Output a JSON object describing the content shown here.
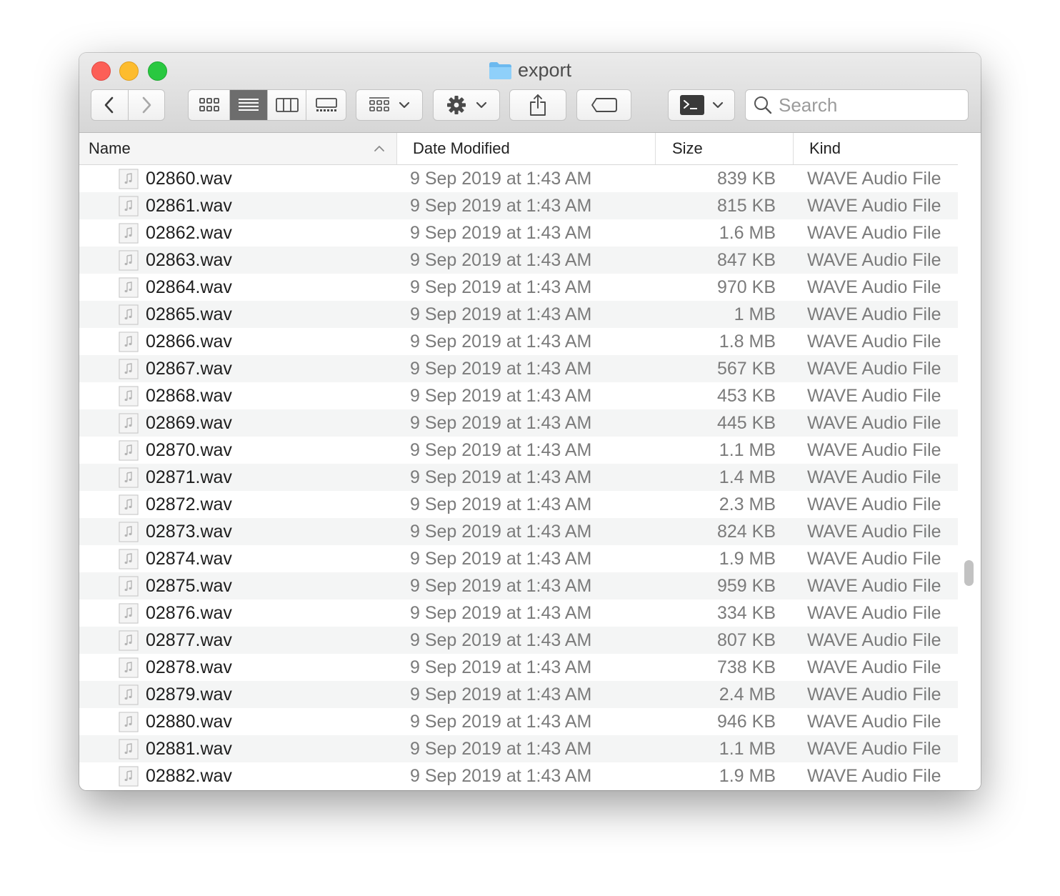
{
  "window": {
    "title": "export"
  },
  "toolbar": {
    "view_modes": [
      "icon-view",
      "list-view",
      "column-view",
      "gallery-view"
    ],
    "active_view": "list-view"
  },
  "search": {
    "placeholder": "Search"
  },
  "columns": {
    "name": "Name",
    "date": "Date Modified",
    "size": "Size",
    "kind": "Kind"
  },
  "files": [
    {
      "name": "02860.wav",
      "date": "9 Sep 2019 at 1:43 AM",
      "size": "839 KB",
      "kind": "WAVE Audio File"
    },
    {
      "name": "02861.wav",
      "date": "9 Sep 2019 at 1:43 AM",
      "size": "815 KB",
      "kind": "WAVE Audio File"
    },
    {
      "name": "02862.wav",
      "date": "9 Sep 2019 at 1:43 AM",
      "size": "1.6 MB",
      "kind": "WAVE Audio File"
    },
    {
      "name": "02863.wav",
      "date": "9 Sep 2019 at 1:43 AM",
      "size": "847 KB",
      "kind": "WAVE Audio File"
    },
    {
      "name": "02864.wav",
      "date": "9 Sep 2019 at 1:43 AM",
      "size": "970 KB",
      "kind": "WAVE Audio File"
    },
    {
      "name": "02865.wav",
      "date": "9 Sep 2019 at 1:43 AM",
      "size": "1 MB",
      "kind": "WAVE Audio File"
    },
    {
      "name": "02866.wav",
      "date": "9 Sep 2019 at 1:43 AM",
      "size": "1.8 MB",
      "kind": "WAVE Audio File"
    },
    {
      "name": "02867.wav",
      "date": "9 Sep 2019 at 1:43 AM",
      "size": "567 KB",
      "kind": "WAVE Audio File"
    },
    {
      "name": "02868.wav",
      "date": "9 Sep 2019 at 1:43 AM",
      "size": "453 KB",
      "kind": "WAVE Audio File"
    },
    {
      "name": "02869.wav",
      "date": "9 Sep 2019 at 1:43 AM",
      "size": "445 KB",
      "kind": "WAVE Audio File"
    },
    {
      "name": "02870.wav",
      "date": "9 Sep 2019 at 1:43 AM",
      "size": "1.1 MB",
      "kind": "WAVE Audio File"
    },
    {
      "name": "02871.wav",
      "date": "9 Sep 2019 at 1:43 AM",
      "size": "1.4 MB",
      "kind": "WAVE Audio File"
    },
    {
      "name": "02872.wav",
      "date": "9 Sep 2019 at 1:43 AM",
      "size": "2.3 MB",
      "kind": "WAVE Audio File"
    },
    {
      "name": "02873.wav",
      "date": "9 Sep 2019 at 1:43 AM",
      "size": "824 KB",
      "kind": "WAVE Audio File"
    },
    {
      "name": "02874.wav",
      "date": "9 Sep 2019 at 1:43 AM",
      "size": "1.9 MB",
      "kind": "WAVE Audio File"
    },
    {
      "name": "02875.wav",
      "date": "9 Sep 2019 at 1:43 AM",
      "size": "959 KB",
      "kind": "WAVE Audio File"
    },
    {
      "name": "02876.wav",
      "date": "9 Sep 2019 at 1:43 AM",
      "size": "334 KB",
      "kind": "WAVE Audio File"
    },
    {
      "name": "02877.wav",
      "date": "9 Sep 2019 at 1:43 AM",
      "size": "807 KB",
      "kind": "WAVE Audio File"
    },
    {
      "name": "02878.wav",
      "date": "9 Sep 2019 at 1:43 AM",
      "size": "738 KB",
      "kind": "WAVE Audio File"
    },
    {
      "name": "02879.wav",
      "date": "9 Sep 2019 at 1:43 AM",
      "size": "2.4 MB",
      "kind": "WAVE Audio File"
    },
    {
      "name": "02880.wav",
      "date": "9 Sep 2019 at 1:43 AM",
      "size": "946 KB",
      "kind": "WAVE Audio File"
    },
    {
      "name": "02881.wav",
      "date": "9 Sep 2019 at 1:43 AM",
      "size": "1.1 MB",
      "kind": "WAVE Audio File"
    },
    {
      "name": "02882.wav",
      "date": "9 Sep 2019 at 1:43 AM",
      "size": "1.9 MB",
      "kind": "WAVE Audio File"
    }
  ]
}
